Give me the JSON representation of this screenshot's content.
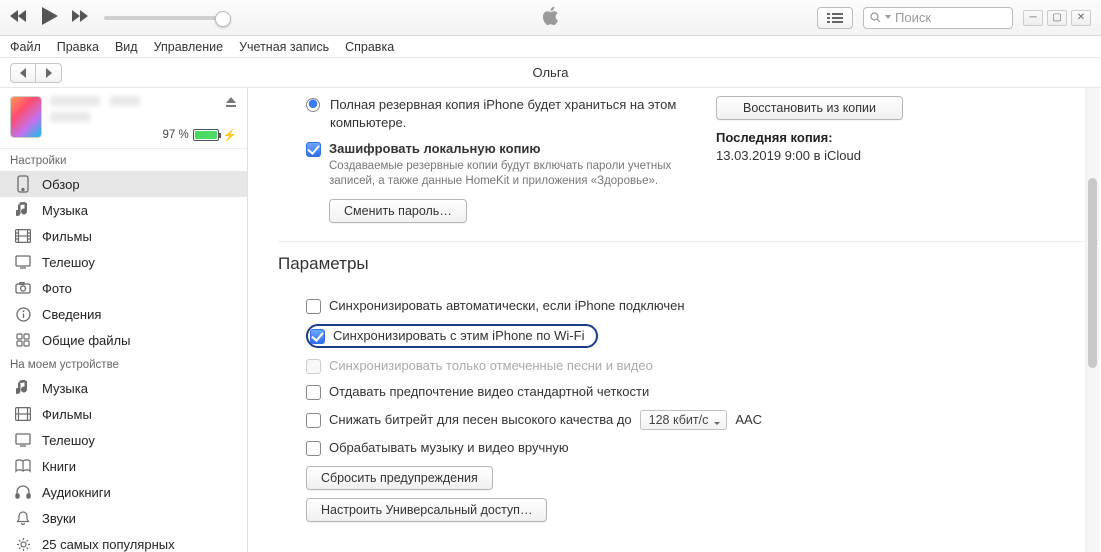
{
  "search_placeholder": "Поиск",
  "menu": {
    "file": "Файл",
    "edit": "Правка",
    "view": "Вид",
    "control": "Управление",
    "account": "Учетная запись",
    "help": "Справка"
  },
  "page_title": "Ольга",
  "device": {
    "battery_pct": "97 %"
  },
  "sidebar": {
    "settings_title": "Настройки",
    "settings": [
      "Обзор",
      "Музыка",
      "Фильмы",
      "Телешоу",
      "Фото",
      "Сведения",
      "Общие файлы"
    ],
    "ondevice_title": "На моем устройстве",
    "ondevice": [
      "Музыка",
      "Фильмы",
      "Телешоу",
      "Книги",
      "Аудиокниги",
      "Звуки",
      "25 самых популярных"
    ]
  },
  "backup": {
    "full_text": "Полная резервная копия iPhone будет храниться на этом компьютере.",
    "encrypt_label": "Зашифровать локальную копию",
    "encrypt_sub": "Создаваемые резервные копии будут включать пароли учетных записей, а также данные HomeKit и приложения «Здоровье».",
    "change_pw_btn": "Сменить пароль…",
    "restore_btn": "Восстановить из копии",
    "last_label": "Последняя копия:",
    "last_value": "13.03.2019 9:00 в iCloud"
  },
  "params": {
    "title": "Параметры",
    "opt_autosync": "Синхронизировать автоматически, если iPhone подключен",
    "opt_wifi": "Синхронизировать с этим iPhone по Wi-Fi",
    "opt_checked_only": "Синхронизировать только отмеченные песни и видео",
    "opt_sd": "Отдавать предпочтение видео стандартной четкости",
    "opt_bitrate": "Снижать битрейт для песен высокого качества до",
    "bitrate_value": "128 кбит/с",
    "bitrate_codec": "AAC",
    "opt_manual": "Обрабатывать музыку и видео вручную",
    "reset_btn": "Сбросить предупреждения",
    "universal_btn": "Настроить Универсальный доступ…"
  }
}
